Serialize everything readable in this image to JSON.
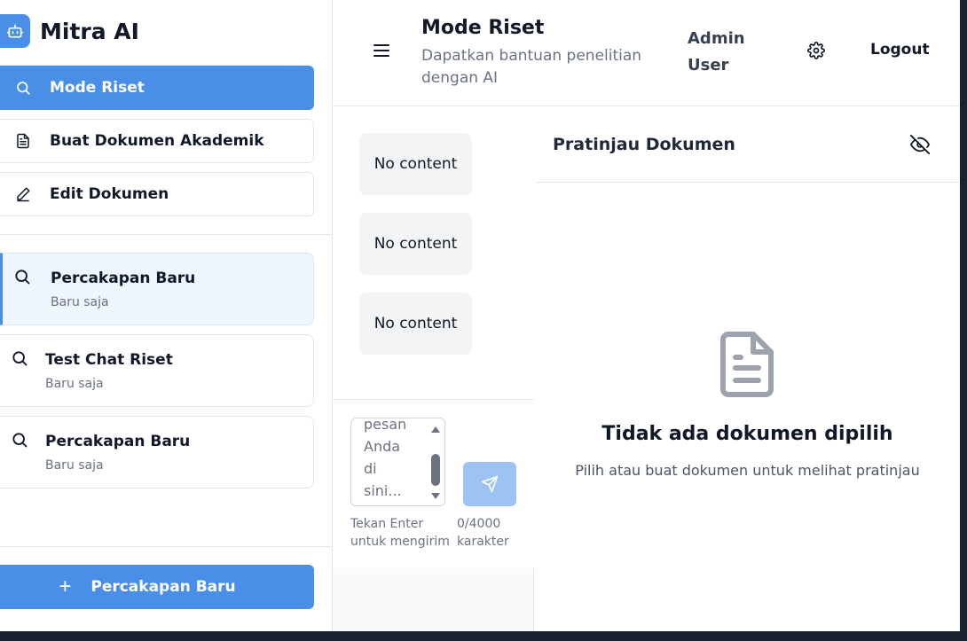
{
  "app": {
    "title": "Mitra AI",
    "logo_icon": "robot-icon",
    "accent": "#4a8fe7"
  },
  "nav": [
    {
      "label": "Mode Riset",
      "icon": "search-icon",
      "active": true
    },
    {
      "label": "Buat Dokumen Akademik",
      "icon": "document-icon",
      "active": false
    },
    {
      "label": "Edit Dokumen",
      "icon": "pencil-icon",
      "active": false
    }
  ],
  "chats": [
    {
      "title": "Percakapan Baru",
      "time": "Baru saja",
      "active": true
    },
    {
      "title": "Test Chat Riset",
      "time": "Baru saja",
      "active": false
    },
    {
      "title": "Percakapan Baru",
      "time": "Baru saja",
      "active": false
    }
  ],
  "new_chat_label": "Percakapan Baru",
  "header": {
    "title": "Mode Riset",
    "subtitle": "Dapatkan bantuan penelitian dengan AI",
    "user": "Admin User",
    "logout": "Logout"
  },
  "messages": [
    "No content",
    "No content",
    "No content"
  ],
  "composer": {
    "placeholder_visible": "pesan Anda di sini...",
    "hint": "Tekan Enter untuk mengirim",
    "counter": "0/4000 karakter"
  },
  "preview": {
    "title": "Pratinjau Dokumen",
    "empty_title": "Tidak ada dokumen dipilih",
    "empty_sub": "Pilih atau buat dokumen untuk melihat pratinjau"
  }
}
